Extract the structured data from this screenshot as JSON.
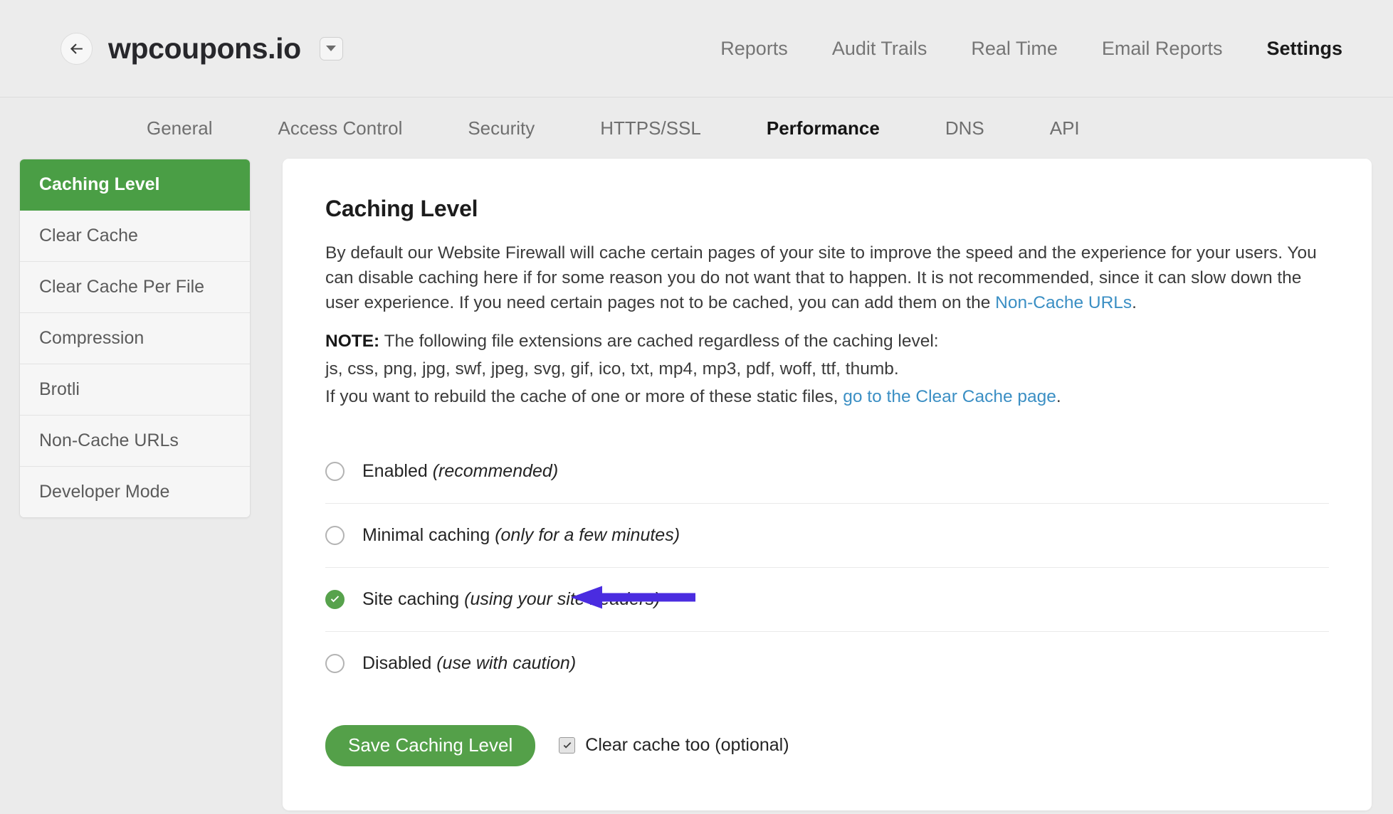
{
  "header": {
    "back_icon": "arrow-left-icon",
    "site_title": "wpcoupons.io",
    "dropdown_icon": "chevron-down-icon",
    "nav": [
      {
        "label": "Reports",
        "active": false
      },
      {
        "label": "Audit Trails",
        "active": false
      },
      {
        "label": "Real Time",
        "active": false
      },
      {
        "label": "Email Reports",
        "active": false
      },
      {
        "label": "Settings",
        "active": true
      }
    ]
  },
  "subtabs": [
    {
      "label": "General",
      "active": false
    },
    {
      "label": "Access Control",
      "active": false
    },
    {
      "label": "Security",
      "active": false
    },
    {
      "label": "HTTPS/SSL",
      "active": false
    },
    {
      "label": "Performance",
      "active": true
    },
    {
      "label": "DNS",
      "active": false
    },
    {
      "label": "API",
      "active": false
    }
  ],
  "sidebar": {
    "items": [
      {
        "label": "Caching Level",
        "active": true
      },
      {
        "label": "Clear Cache",
        "active": false
      },
      {
        "label": "Clear Cache Per File",
        "active": false
      },
      {
        "label": "Compression",
        "active": false
      },
      {
        "label": "Brotli",
        "active": false
      },
      {
        "label": "Non-Cache URLs",
        "active": false
      },
      {
        "label": "Developer Mode",
        "active": false
      }
    ]
  },
  "main": {
    "title": "Caching Level",
    "intro_part1": "By default our Website Firewall will cache certain pages of your site to improve the speed and the experience for your users. You can disable caching here if for some reason you do not want that to happen. It is not recommended, since it can slow down the user experience. If you need certain pages not to be cached, you can add them on the ",
    "intro_link": "Non-Cache URLs",
    "intro_part2": ".",
    "note_label": "NOTE:",
    "note_text": " The following file extensions are cached regardless of the caching level:",
    "extensions": "js, css, png, jpg, swf, jpeg, svg, gif, ico, txt, mp4, mp3, pdf, woff, ttf, thumb.",
    "rebuild_part1": "If you want to rebuild the cache of one or more of these static files, ",
    "rebuild_link": "go to the Clear Cache page",
    "rebuild_part2": ".",
    "options": [
      {
        "name": "Enabled",
        "hint": "(recommended)",
        "checked": false
      },
      {
        "name": "Minimal caching",
        "hint": "(only for a few minutes)",
        "checked": false
      },
      {
        "name": "Site caching",
        "hint": "(using your site headers)",
        "checked": true
      },
      {
        "name": "Disabled",
        "hint": "(use with caution)",
        "checked": false
      }
    ],
    "save_label": "Save Caching Level",
    "clear_cache_checkbox_label": "Clear cache too (optional)",
    "clear_cache_checked": true
  },
  "annotation": {
    "type": "arrow-left-annotation",
    "color": "#4a2ce0",
    "points_at": "Site caching (using your site headers)"
  },
  "colors": {
    "brand_green": "#4a9e45",
    "save_green": "#54a049",
    "link_blue": "#3b8fc4",
    "page_bg": "#ebebeb",
    "annotation_purple": "#4a2ce0"
  }
}
